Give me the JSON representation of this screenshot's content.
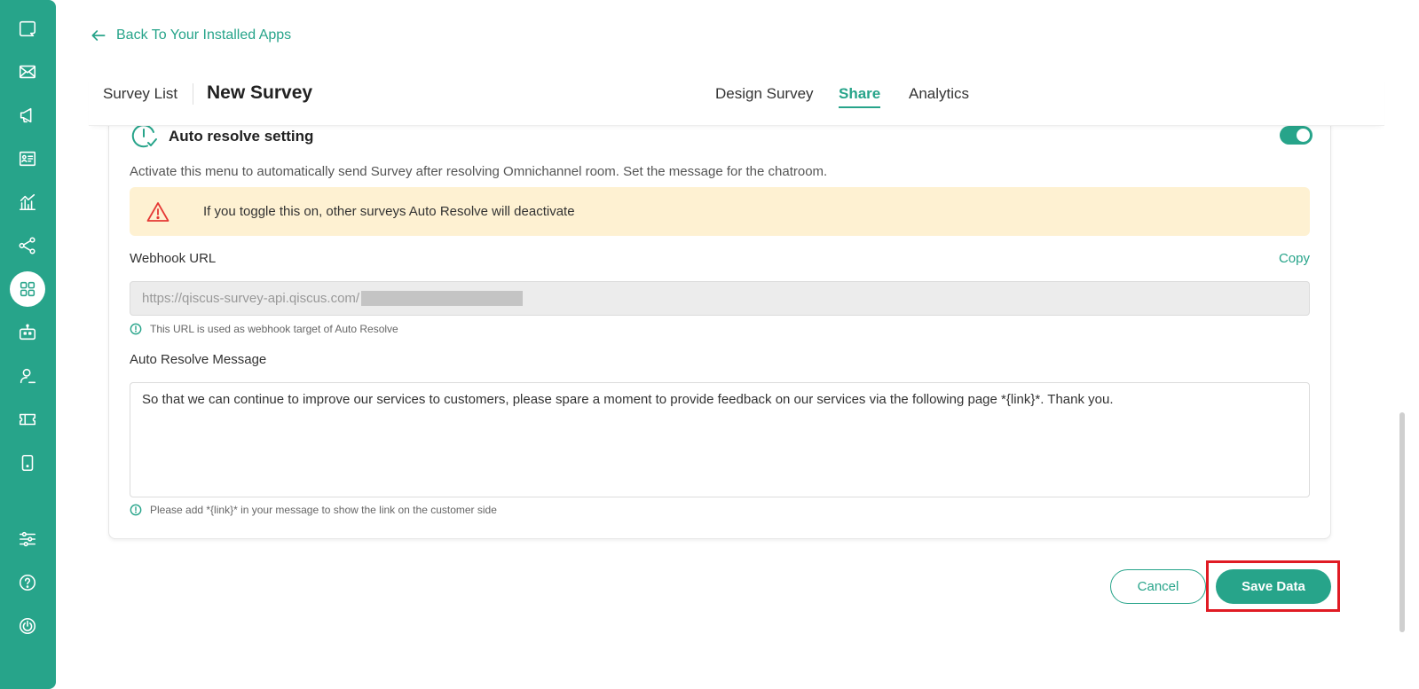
{
  "header": {
    "back_label": "Back To Your Installed Apps",
    "breadcrumb": "Survey List",
    "title": "New Survey",
    "tabs": [
      {
        "label": "Design Survey",
        "active": false
      },
      {
        "label": "Share",
        "active": true
      },
      {
        "label": "Analytics",
        "active": false
      }
    ]
  },
  "sidebar": {
    "icons": [
      "chat-icon",
      "mail-icon",
      "broadcast-icon",
      "contact-card-icon",
      "analytics-icon",
      "integration-icon",
      "apps-icon",
      "bot-icon",
      "agent-icon",
      "ticket-icon",
      "mobile-icon",
      "settings-sliders-icon",
      "help-icon",
      "power-icon"
    ],
    "active": "apps-icon"
  },
  "auto_resolve": {
    "title": "Auto resolve setting",
    "enabled": true,
    "description": "Activate this menu to automatically send Survey after resolving Omnichannel room. Set the message for the chatroom.",
    "warning": "If you toggle this on, other surveys Auto Resolve will deactivate",
    "webhook_label": "Webhook URL",
    "copy_label": "Copy",
    "webhook_url": "https://qiscus-survey-api.qiscus.com/",
    "webhook_hint": "This URL is used as webhook target of Auto Resolve",
    "message_label": "Auto Resolve Message",
    "message_value": "So that we can continue to improve our services to customers, please spare a moment to provide feedback on our services via the following page *{link}*. Thank you.",
    "message_hint": "Please add *{link}* in your message to show the link on the customer side"
  },
  "actions": {
    "cancel_label": "Cancel",
    "save_label": "Save Data"
  },
  "colors": {
    "brand": "#27a48a",
    "warning_bg": "#fef1d2",
    "warning_icon": "#e53935",
    "highlight": "#e01b24"
  }
}
